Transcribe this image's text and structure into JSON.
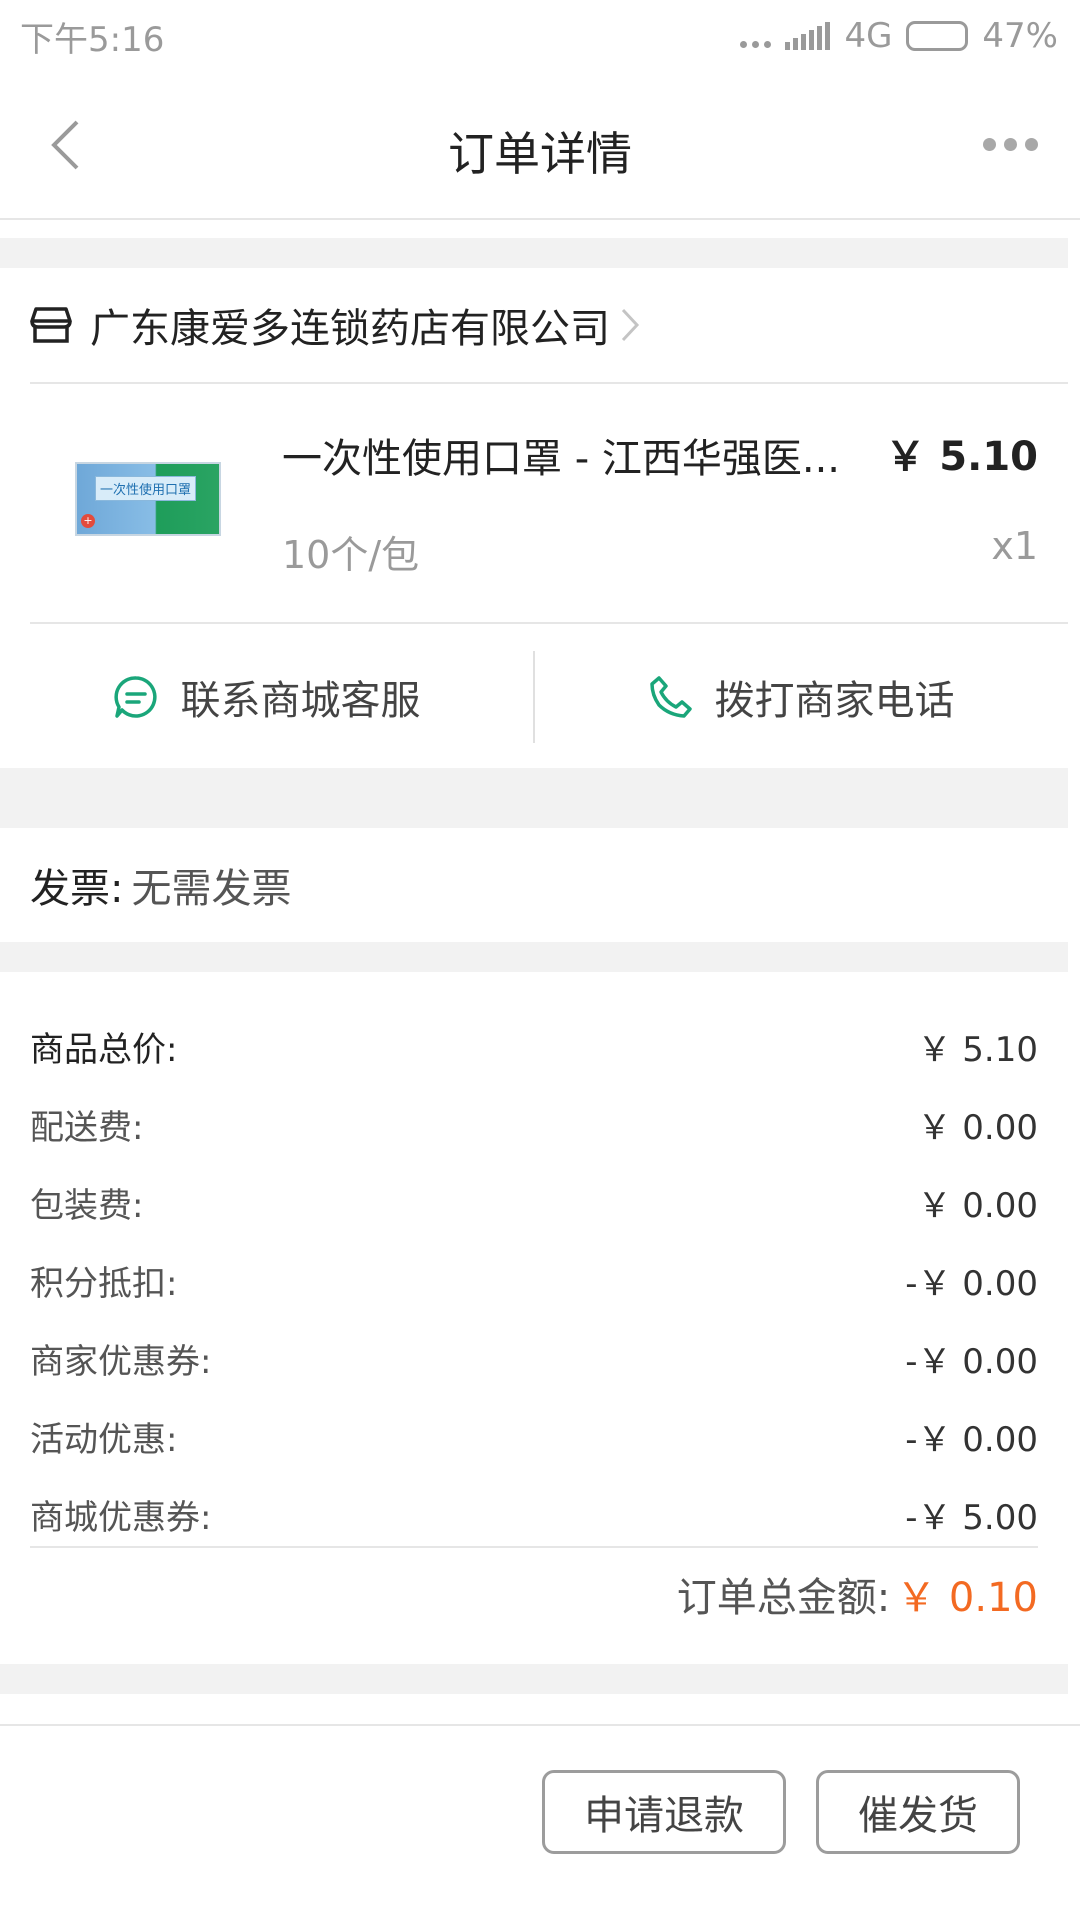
{
  "status_bar": {
    "time": "下午5:16",
    "network": "4G",
    "battery": "47%",
    "battery_level": 0.47
  },
  "header": {
    "title": "订单详情",
    "back_icon": "chevron-left-icon",
    "more_icon": "more-horizontal-icon"
  },
  "store": {
    "icon": "store-icon",
    "name": "广东康爱多连锁药店有限公司"
  },
  "product": {
    "name": "一次性使用口罩 - 江西华强医...",
    "price": "￥ 5.10",
    "spec": "10个/包",
    "quantity": "x1",
    "thumb_text": "一次性使用口罩"
  },
  "contact": {
    "service_label": "联系商城客服",
    "phone_label": "拨打商家电话"
  },
  "invoice": {
    "label": "发票:",
    "value": "无需发票"
  },
  "summary": {
    "rows": [
      {
        "label": "商品总价:",
        "value": "￥ 5.10"
      },
      {
        "label": "配送费:",
        "value": "￥ 0.00"
      },
      {
        "label": "包装费:",
        "value": "￥ 0.00"
      },
      {
        "label": "积分抵扣:",
        "value": "-￥ 0.00"
      },
      {
        "label": "商家优惠券:",
        "value": "-￥ 0.00"
      },
      {
        "label": "活动优惠:",
        "value": "-￥ 0.00"
      },
      {
        "label": "商城优惠券:",
        "value": "-￥ 5.00"
      }
    ],
    "total_label": "订单总金额:",
    "total_value": "￥ 0.10"
  },
  "actions": {
    "refund_label": "申请退款",
    "urge_label": "催发货"
  },
  "colors": {
    "accent_green": "#1aa67a",
    "total_orange": "#f36a22",
    "page_gray": "#f2f2f2"
  }
}
